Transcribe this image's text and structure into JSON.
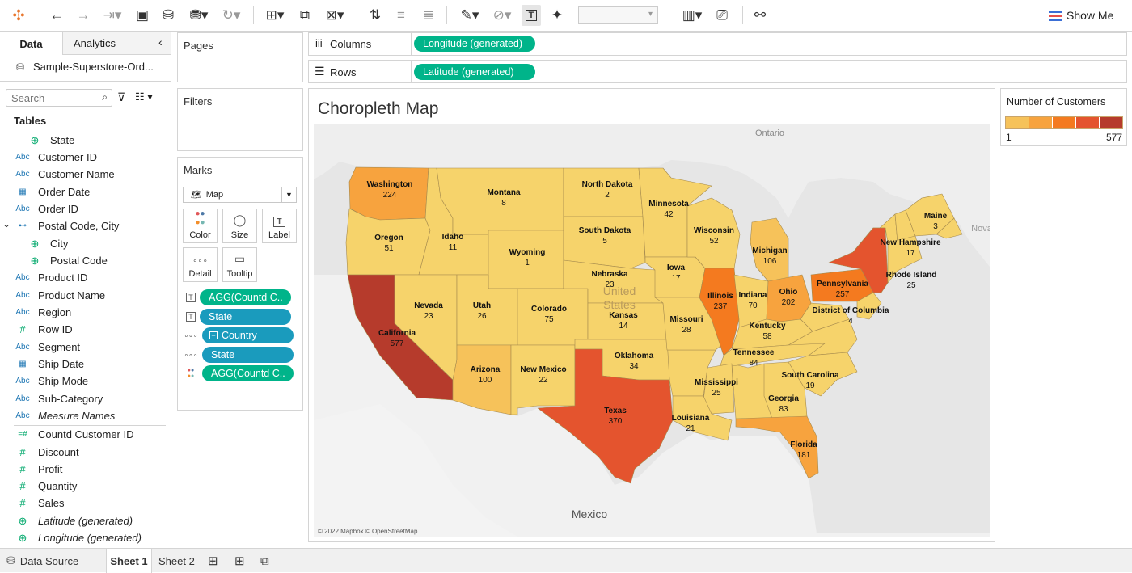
{
  "toolbar": {
    "show_me": "Show Me"
  },
  "sidebar": {
    "tab_data": "Data",
    "tab_analytics": "Analytics",
    "datasource": "Sample-Superstore-Ord...",
    "search_placeholder": "Search",
    "tables_label": "Tables",
    "fields": [
      {
        "label": "State",
        "type": "geo"
      },
      {
        "label": "Customer ID",
        "type": "abc"
      },
      {
        "label": "Customer Name",
        "type": "abc"
      },
      {
        "label": "Order Date",
        "type": "date"
      },
      {
        "label": "Order ID",
        "type": "abc"
      },
      {
        "label": "Postal Code, City",
        "type": "hier"
      },
      {
        "label": "City",
        "type": "geo"
      },
      {
        "label": "Postal Code",
        "type": "geo"
      },
      {
        "label": "Product ID",
        "type": "abc"
      },
      {
        "label": "Product Name",
        "type": "abc"
      },
      {
        "label": "Region",
        "type": "abc"
      },
      {
        "label": "Row ID",
        "type": "num"
      },
      {
        "label": "Segment",
        "type": "abc"
      },
      {
        "label": "Ship Date",
        "type": "date"
      },
      {
        "label": "Ship Mode",
        "type": "abc"
      },
      {
        "label": "Sub-Category",
        "type": "abc"
      },
      {
        "label": "Measure Names",
        "type": "abc"
      },
      {
        "label": "Countd Customer ID",
        "type": "calc"
      },
      {
        "label": "Discount",
        "type": "num"
      },
      {
        "label": "Profit",
        "type": "num"
      },
      {
        "label": "Quantity",
        "type": "num"
      },
      {
        "label": "Sales",
        "type": "num"
      },
      {
        "label": "Latitude (generated)",
        "type": "geo"
      },
      {
        "label": "Longitude (generated)",
        "type": "geo"
      }
    ]
  },
  "pages": {
    "label": "Pages"
  },
  "filters": {
    "label": "Filters"
  },
  "marks": {
    "label": "Marks",
    "type": "Map",
    "buttons": {
      "color": "Color",
      "size": "Size",
      "label": "Label",
      "detail": "Detail",
      "tooltip": "Tooltip"
    },
    "pills": [
      "AGG(Countd C..",
      "State",
      "Country",
      "State",
      "AGG(Countd C.."
    ]
  },
  "shelves": {
    "columns_label": "Columns",
    "columns_pill": "Longitude (generated)",
    "rows_label": "Rows",
    "rows_pill": "Latitude (generated)"
  },
  "sheet_title": "Choropleth Map",
  "legend": {
    "title": "Number of Customers",
    "min": "1",
    "max": "577",
    "colors": [
      "#f6c25a",
      "#f7a33e",
      "#f47a1f",
      "#e4542e",
      "#b63b2c"
    ]
  },
  "map": {
    "attribution": "© 2022 Mapbox © OpenStreetMap",
    "labels": {
      "ontario": "Ontario",
      "mexico": "Mexico",
      "us": "United\nStates",
      "nova": "Nova"
    }
  },
  "states": [
    {
      "name": "Washington",
      "value": "224"
    },
    {
      "name": "Oregon",
      "value": "51"
    },
    {
      "name": "California",
      "value": "577"
    },
    {
      "name": "Idaho",
      "value": "11"
    },
    {
      "name": "Nevada",
      "value": "23"
    },
    {
      "name": "Montana",
      "value": "8"
    },
    {
      "name": "Wyoming",
      "value": "1"
    },
    {
      "name": "Utah",
      "value": "26"
    },
    {
      "name": "Arizona",
      "value": "100"
    },
    {
      "name": "Colorado",
      "value": "75"
    },
    {
      "name": "New Mexico",
      "value": "22"
    },
    {
      "name": "North Dakota",
      "value": "2"
    },
    {
      "name": "South Dakota",
      "value": "5"
    },
    {
      "name": "Nebraska",
      "value": "23"
    },
    {
      "name": "Kansas",
      "value": "14"
    },
    {
      "name": "Oklahoma",
      "value": "34"
    },
    {
      "name": "Texas",
      "value": "370"
    },
    {
      "name": "Minnesota",
      "value": "42"
    },
    {
      "name": "Iowa",
      "value": "17"
    },
    {
      "name": "Missouri",
      "value": "28"
    },
    {
      "name": "Wisconsin",
      "value": "52"
    },
    {
      "name": "Illinois",
      "value": "237"
    },
    {
      "name": "Michigan",
      "value": "106"
    },
    {
      "name": "Indiana",
      "value": "70"
    },
    {
      "name": "Ohio",
      "value": "202"
    },
    {
      "name": "Kentucky",
      "value": "58"
    },
    {
      "name": "Tennessee",
      "value": "84"
    },
    {
      "name": "Mississippi",
      "value": "25"
    },
    {
      "name": "Louisiana",
      "value": "21"
    },
    {
      "name": "Georgia",
      "value": "83"
    },
    {
      "name": "Florida",
      "value": "181"
    },
    {
      "name": "South Carolina",
      "value": "19"
    },
    {
      "name": "Pennsylvania",
      "value": "257"
    },
    {
      "name": "District of Columbia",
      "value": "4"
    },
    {
      "name": "New Hampshire",
      "value": "17"
    },
    {
      "name": "Maine",
      "value": "3"
    },
    {
      "name": "Rhode Island",
      "value": "25"
    }
  ],
  "bottom": {
    "data_source": "Data Source",
    "sheet1": "Sheet 1",
    "sheet2": "Sheet 2"
  }
}
